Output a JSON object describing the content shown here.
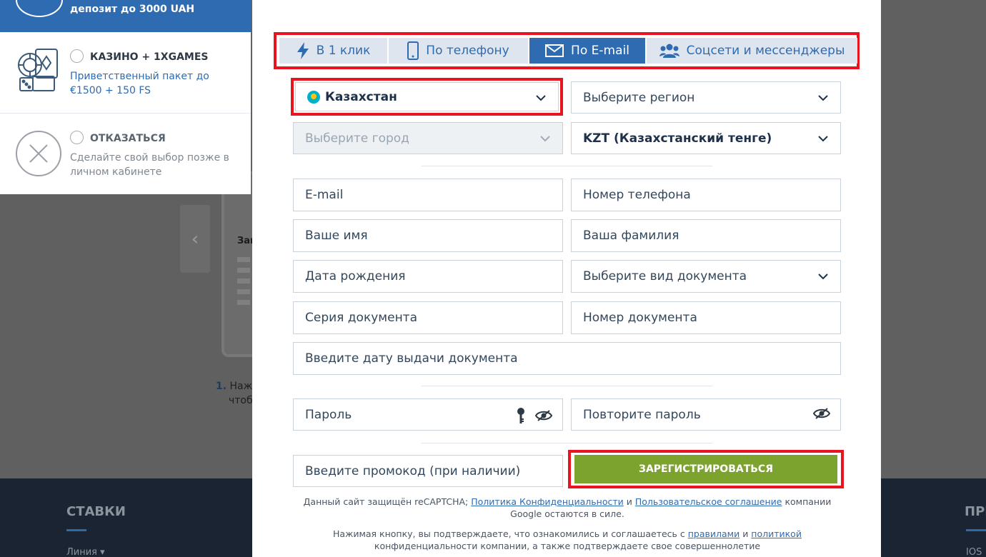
{
  "background": {
    "card_title": "Зап",
    "step_number": "1.",
    "step_text_line1": "Наж",
    "step_text_line2": "чтоб",
    "footer_title": "СТАВКИ",
    "footer_link": "Линия ▾",
    "footer_title_right": "ПРИ",
    "footer_link_right": "IOS"
  },
  "bonus_panel": {
    "top_text": "депозит до 3000 UAH",
    "items": [
      {
        "title": "КАЗИНО + 1XGAMES",
        "desc": "Приветственный пакет до €1500 + 150 FS"
      },
      {
        "title": "ОТКАЗАТЬСЯ",
        "desc": "Сделайте свой выбор позже в личном кабинете"
      }
    ]
  },
  "tabs": [
    {
      "label": "В 1 клик",
      "icon": "lightning-icon"
    },
    {
      "label": "По телефону",
      "icon": "phone-icon"
    },
    {
      "label": "По E-mail",
      "icon": "envelope-icon",
      "active": true
    },
    {
      "label": "Соцсети и мессенджеры",
      "icon": "users-icon"
    }
  ],
  "form": {
    "country": "Казахстан",
    "region_placeholder": "Выберите регион",
    "city_placeholder": "Выберите город",
    "currency": "KZT (Казахстанский тенге)",
    "email_placeholder": "E-mail",
    "phone_placeholder": "Номер телефона",
    "name_placeholder": "Ваше имя",
    "surname_placeholder": "Ваша фамилия",
    "birthdate_placeholder": "Дата рождения",
    "doc_type_placeholder": "Выберите вид документа",
    "doc_series_placeholder": "Серия документа",
    "doc_number_placeholder": "Номер документа",
    "doc_date_placeholder": "Введите дату выдачи документа",
    "password_placeholder": "Пароль",
    "password_repeat_placeholder": "Повторите пароль",
    "promo_placeholder": "Введите промокод (при наличии)",
    "register_label": "ЗАРЕГИСТРИРОВАТЬСЯ"
  },
  "legal": {
    "recaptcha_prefix": "Данный сайт защищён reCAPTCHA; ",
    "privacy_link": "Политика Конфиденциальности",
    "and1": " и ",
    "terms_link": "Пользовательское соглашение",
    "recaptcha_suffix": " компании Google остаются в силе.",
    "confirm_prefix": "Нажимая кнопку, вы подтверждаете, что ознакомились и соглашаетесь с ",
    "rules_link": "правилами",
    "and2": " и ",
    "policy_link": "политикой",
    "confirm_suffix": " конфиденциальности компании, а также подтверждаете свое совершеннолетие"
  },
  "colors": {
    "brand_blue": "#2f6bb0",
    "register_green": "#7ca32e",
    "highlight_red": "#e8141f"
  }
}
